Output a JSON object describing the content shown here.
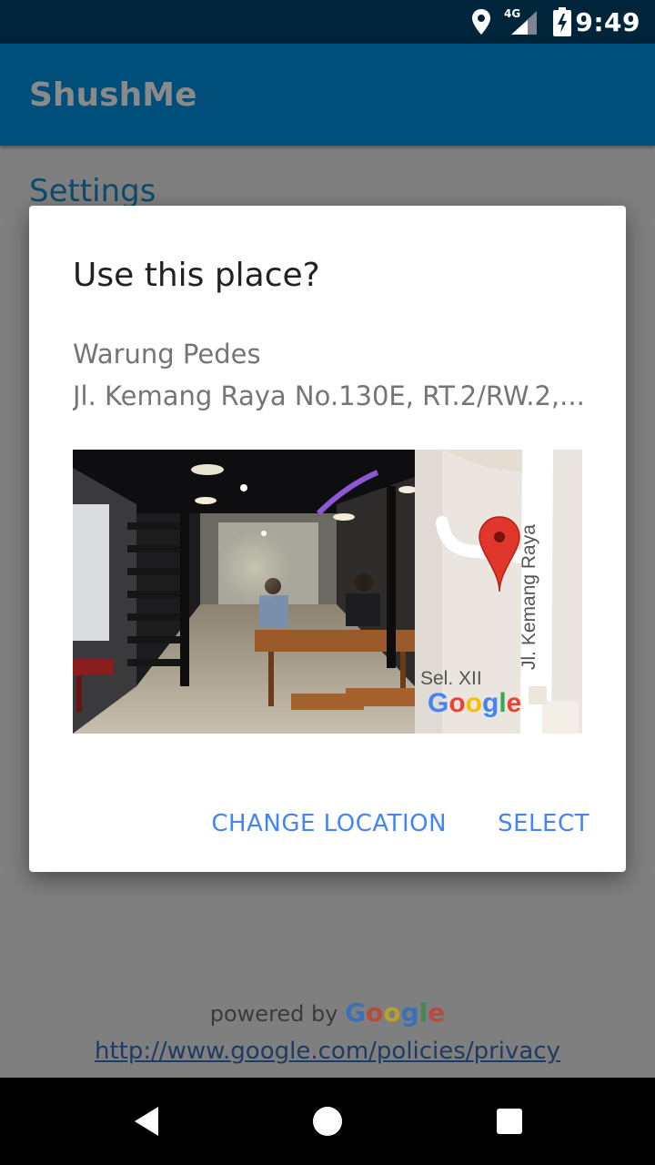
{
  "status_bar": {
    "time": "9:49",
    "network": "4G",
    "icons": [
      "location-icon",
      "signal-icon",
      "battery-charging-icon"
    ]
  },
  "app_bar": {
    "title": "ShushMe"
  },
  "background": {
    "settings_heading": "Settings",
    "attribution_prefix": "powered by",
    "attribution_brand": [
      "G",
      "o",
      "o",
      "g",
      "l",
      "e"
    ],
    "policy_link": "http://www.google.com/policies/privacy"
  },
  "dialog": {
    "title": "Use this place?",
    "place_name": "Warung Pedes",
    "place_address": "Jl. Kemang Raya No.130E, RT.2/RW.2,...",
    "map": {
      "street_label": "Jl. Kemang Raya",
      "area_label": "Sel. XII",
      "brand": [
        "G",
        "o",
        "o",
        "g",
        "l",
        "e"
      ]
    },
    "buttons": {
      "change_location": "CHANGE LOCATION",
      "select": "SELECT"
    }
  },
  "colors": {
    "status_bar": "#00243a",
    "app_bar": "#004e7a",
    "scrim": "#7f7f7f",
    "accent": "#4285f4"
  }
}
